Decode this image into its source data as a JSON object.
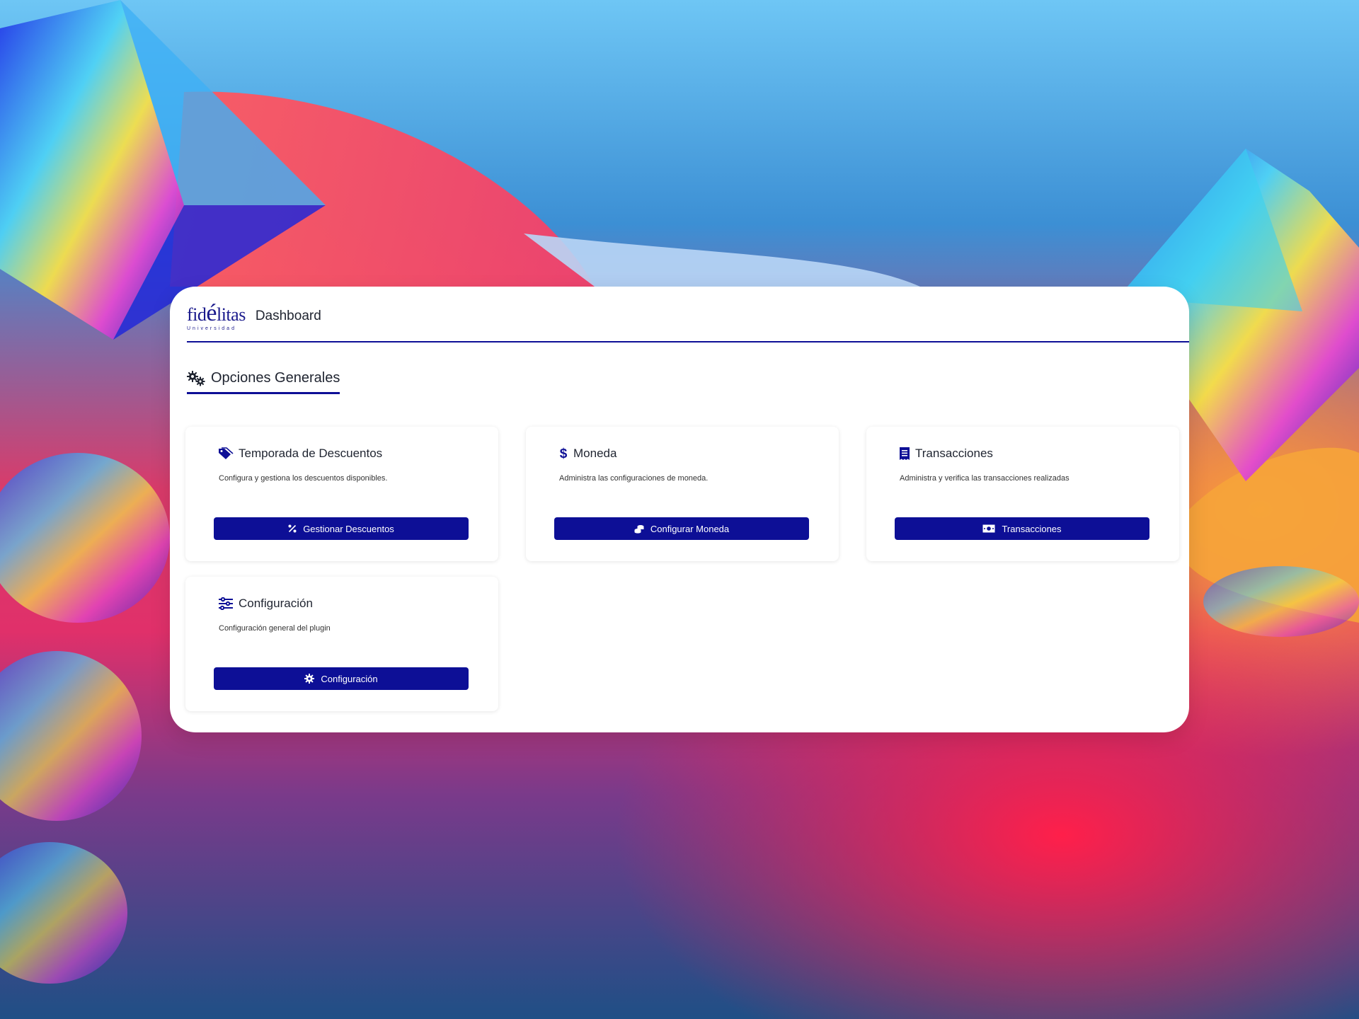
{
  "colors": {
    "primary": "#0d0f96",
    "text": "#1f2430"
  },
  "brand": {
    "logo_main": "fidélitas",
    "logo_sub": "Universidad"
  },
  "header": {
    "title": "Dashboard"
  },
  "section": {
    "title": "Opciones Generales",
    "icon": "gears-icon"
  },
  "cards": [
    {
      "title": "Temporada de Descuentos",
      "icon": "tag-icon",
      "description": "Configura y gestiona los descuentos disponibles.",
      "button_label": "Gestionar Descuentos",
      "button_icon": "percent-icon"
    },
    {
      "title": "Moneda",
      "icon": "dollar-icon",
      "description": "Administra las configuraciones de moneda.",
      "button_label": "Configurar Moneda",
      "button_icon": "coins-icon"
    },
    {
      "title": "Transacciones",
      "icon": "receipt-icon",
      "description": "Administra y verifica las transacciones realizadas",
      "button_label": "Transacciones",
      "button_icon": "money-bill-icon"
    },
    {
      "title": "Configuración",
      "icon": "sliders-icon",
      "description": "Configuración general del plugin",
      "button_label": "Configuración",
      "button_icon": "gear-icon"
    }
  ]
}
